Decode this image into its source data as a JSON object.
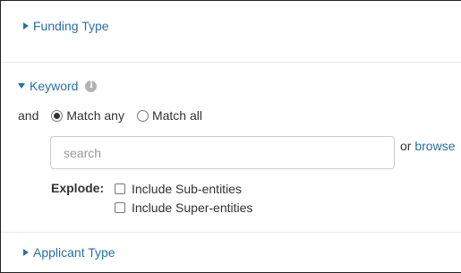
{
  "facets": {
    "funding_type": {
      "label": "Funding Type"
    },
    "keyword": {
      "label": "Keyword",
      "info_icon": "i",
      "and_label": "and",
      "match_any_label": "Match any",
      "match_all_label": "Match all",
      "match_selected": "any",
      "search_placeholder": "search",
      "search_value": "",
      "or_text": "or",
      "browse_label": "browse",
      "explode_label": "Explode:",
      "include_sub_label": "Include Sub-entities",
      "include_super_label": "Include Super-entities"
    },
    "applicant_type": {
      "label": "Applicant Type"
    }
  },
  "icons": {
    "collapsed": "triangle-right-icon",
    "expanded": "triangle-down-icon",
    "info": "info-icon"
  },
  "colors": {
    "link": "#2a6fa8",
    "text": "#333333",
    "divider": "#e8e8e8",
    "info_icon": "#b3b3b3"
  }
}
